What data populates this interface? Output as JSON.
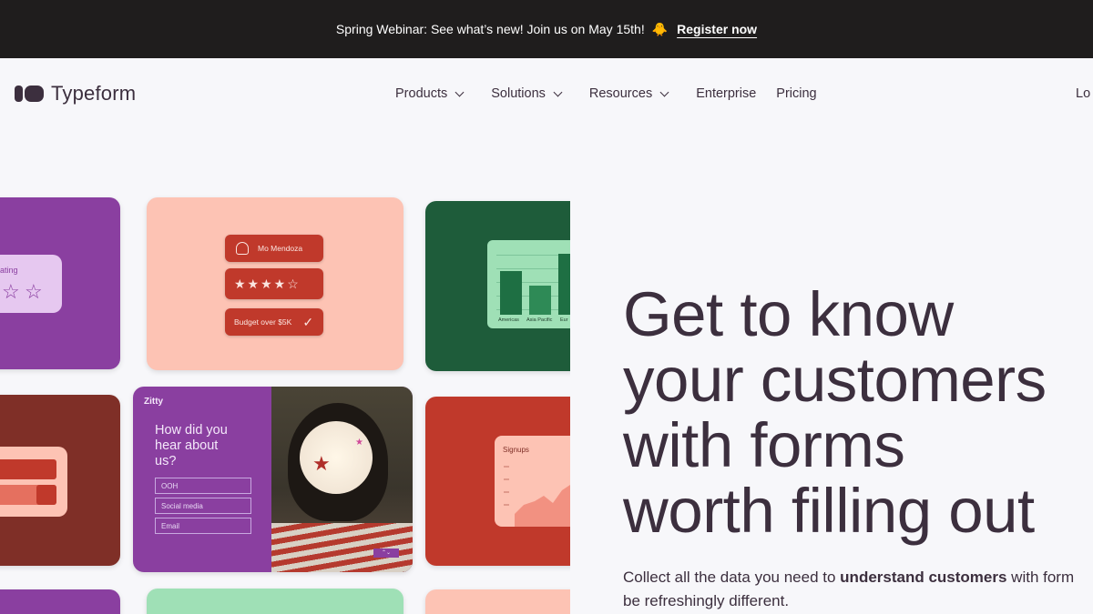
{
  "banner": {
    "text": "Spring Webinar: See what’s new! Join us on May 15th!",
    "emoji": "🐥",
    "link": "Register now"
  },
  "nav": {
    "logo": "Typeform",
    "items": [
      {
        "label": "Products",
        "dropdown": true
      },
      {
        "label": "Solutions",
        "dropdown": true
      },
      {
        "label": "Resources",
        "dropdown": true
      },
      {
        "label": "Enterprise",
        "dropdown": false
      },
      {
        "label": "Pricing",
        "dropdown": false
      }
    ],
    "login": "Lo"
  },
  "hero": {
    "title_lines": [
      "Get to know",
      "your customers",
      "with forms",
      "worth filling out"
    ],
    "sub_line1_pre": "Collect all the data you need to ",
    "sub_line1_bold": "understand customers",
    "sub_line1_post": " with form",
    "sub_line2": "be refreshingly different."
  },
  "tiles": {
    "rating_label": "ating",
    "person_name": "Mo Mendoza",
    "budget_label": "Budget over $5K",
    "chart_labels": [
      "Americas",
      "Asia Pacific",
      "Eur"
    ],
    "zitty_brand": "Zitty",
    "zitty_question": "How did you hear about us?",
    "zitty_options": [
      "OOH",
      "Social media",
      "Email"
    ],
    "signups_label": "Signups"
  },
  "colors": {
    "banner_bg": "#1f1d1d",
    "page_bg": "#f7f7fa",
    "text": "#3c2f3e",
    "purple": "#8a3fa0",
    "peach": "#fdc3b4",
    "green": "#1e5c3a",
    "red": "#c0392b",
    "maroon": "#7f2f27",
    "mint": "#9fe0b6"
  }
}
